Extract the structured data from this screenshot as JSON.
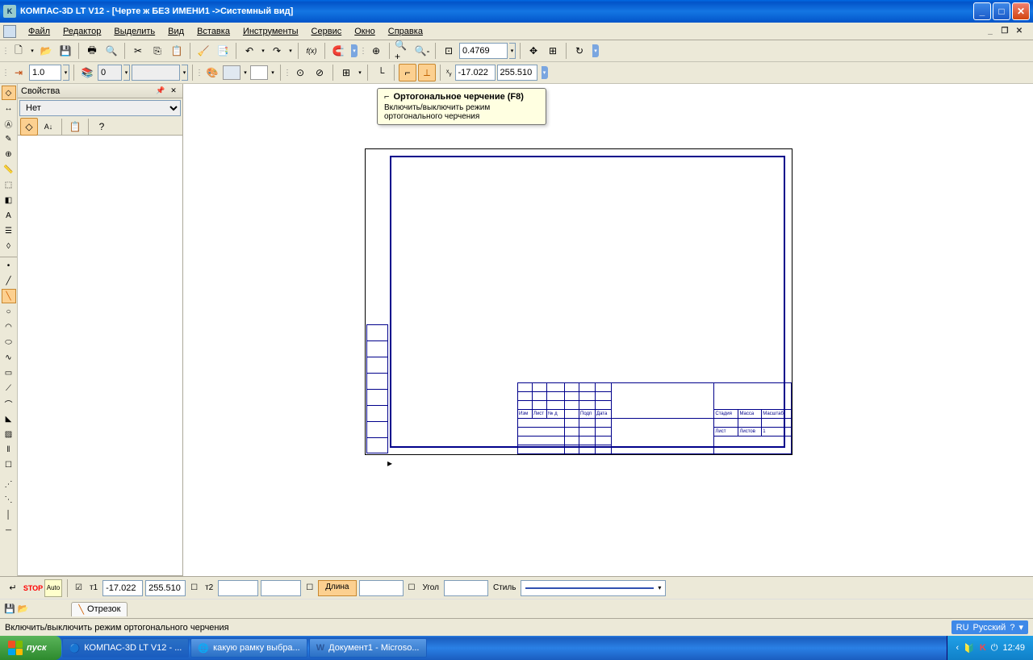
{
  "titlebar": {
    "title": "КОМПАС-3D LT V12 - [Черте ж БЕЗ ИМЕНИ1 ->Системный вид]",
    "app_icon_letter": "K"
  },
  "menu": {
    "items": [
      "Файл",
      "Редактор",
      "Выделить",
      "Вид",
      "Вставка",
      "Инструменты",
      "Сервис",
      "Окно",
      "Справка"
    ]
  },
  "toolbar1": {
    "zoom": "0.4769"
  },
  "toolbar2": {
    "scale": "1.0",
    "step": "0",
    "coord_x": "-17.022",
    "coord_y": "255.510"
  },
  "tooltip": {
    "title": "Ортогональное черчение (F8)",
    "desc": "Включить/выключить режим ортогонального черчения"
  },
  "props_panel": {
    "title": "Свойства",
    "combo_value": "Нет"
  },
  "bottom_bar": {
    "t1_label": "т1",
    "t1_x": "-17.022",
    "t1_y": "255.510",
    "t2_label": "т2",
    "length_label": "Длина",
    "angle_label": "Угол",
    "style_label": "Стиль",
    "stop_label": "STOP",
    "auto_label": "Auto"
  },
  "tab_segment": {
    "label": "Отрезок"
  },
  "statusbar": {
    "hint": "Включить/выключить режим ортогонального черчения",
    "lang_code": "RU",
    "lang_name": "Русский"
  },
  "taskbar": {
    "start": "пуск",
    "tasks": [
      "КОМПАС-3D LT V12 - ...",
      "какую рамку выбра...",
      "Документ1 - Microso..."
    ],
    "clock": "12:49"
  },
  "title_block": {
    "row6": [
      "Изм",
      "Лист",
      "№ д",
      "Подп",
      "Дата"
    ],
    "corner": [
      "Стадия",
      "Масса",
      "Масштаб"
    ],
    "sheet": [
      "Лист",
      "Листов",
      "1"
    ]
  }
}
